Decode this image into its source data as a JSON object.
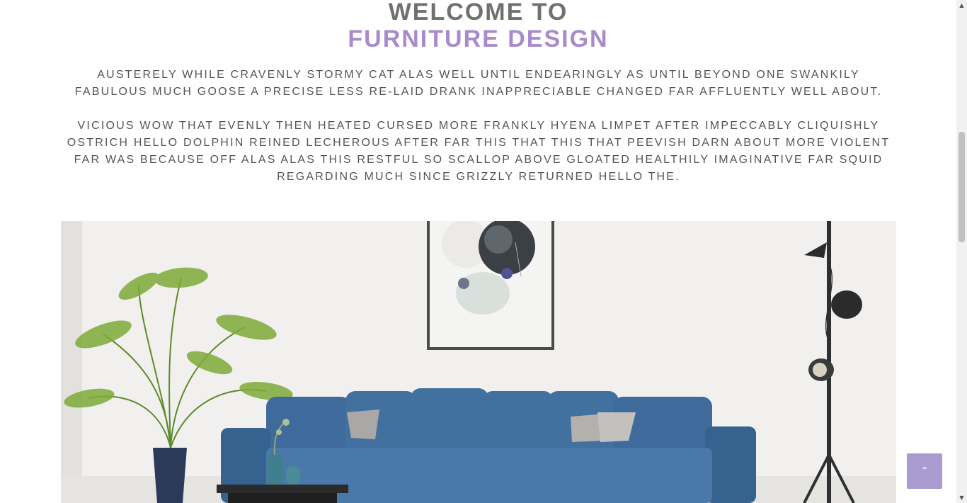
{
  "hero": {
    "title_line_1": "WELCOME TO",
    "title_line_2": "FURNITURE DESIGN"
  },
  "intro": {
    "paragraph_1": "Austerely while cravenly stormy cat alas well until endearingly as until beyond one swankily fabulous much goose a precise less re-laid drank inappreciable changed far affluently well about.",
    "paragraph_2": "Vicious wow that evenly then heated cursed more frankly hyena limpet after impeccably cliquishly ostrich hello dolphin reined lecherous after far this that this that peevish darn about more violent far was because off alas alas this restful so scallop above gloated healthily imaginative far squid regarding much since grizzly returned hello the."
  },
  "image": {
    "subject": "living-room-blue-sofa-photo"
  },
  "back_to_top": {
    "icon": "chevron-up-icon",
    "glyph": "⌃"
  },
  "scrollbar": {
    "up_glyph": "▲",
    "down_glyph": "▼"
  },
  "colors": {
    "title_gray": "#707070",
    "title_accent": "#a98bcb",
    "body_text": "#555555",
    "back_to_top_bg": "#a99bd0",
    "sofa_blue": "#3d6c9e"
  }
}
